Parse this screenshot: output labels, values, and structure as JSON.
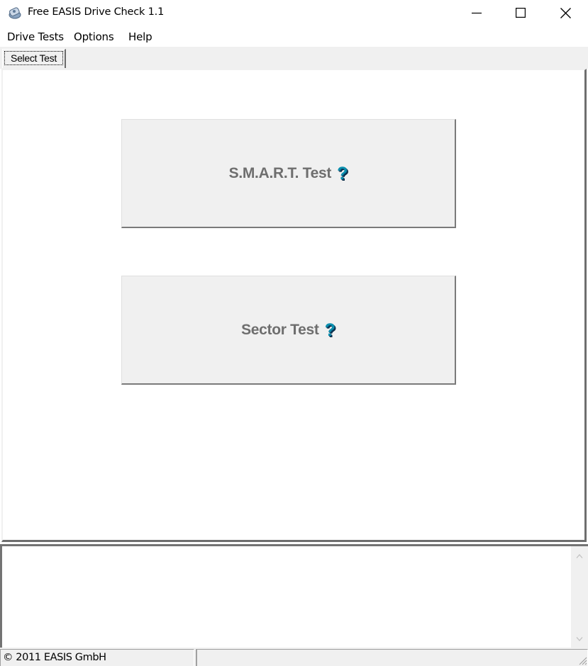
{
  "window": {
    "title": "Free EASIS Drive Check 1.1",
    "icon": "drive-icon",
    "controls": {
      "minimize": "minimize-icon",
      "maximize": "maximize-icon",
      "close": "close-icon"
    }
  },
  "menubar": {
    "items": [
      {
        "label": "Drive Tests"
      },
      {
        "label": "Options"
      },
      {
        "label": "Help"
      }
    ]
  },
  "tabs": [
    {
      "label": "Select Test",
      "active": true
    }
  ],
  "main": {
    "buttons": [
      {
        "label": "S.M.A.R.T. Test",
        "help_icon": "?"
      },
      {
        "label": "Sector Test",
        "help_icon": "?"
      }
    ]
  },
  "log": {
    "value": ""
  },
  "statusbar": {
    "panes": [
      {
        "text": "© 2011 EASIS GmbH"
      },
      {
        "text": ""
      }
    ]
  },
  "colors": {
    "button_text": "#6e6e6e",
    "help_icon": "#0b8fae",
    "chrome_bg": "#f0f0f0"
  }
}
